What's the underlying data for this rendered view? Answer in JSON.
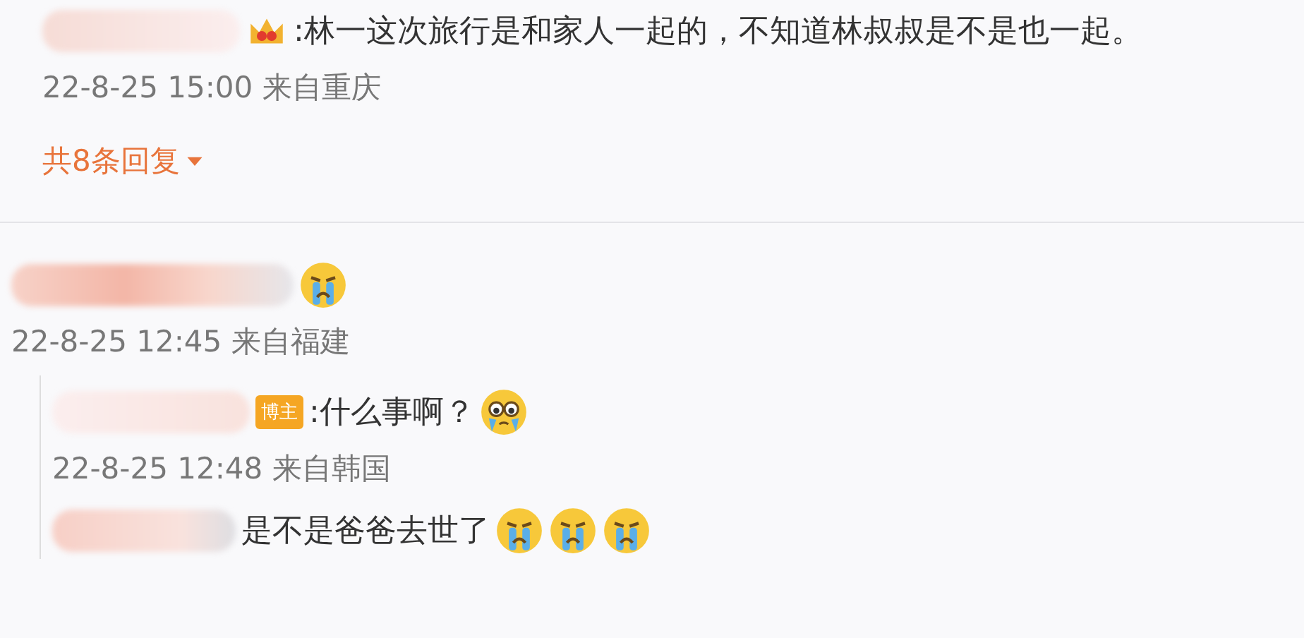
{
  "comment": {
    "badge": {
      "kind": "crown"
    },
    "text": ":林一这次旅行是和家人一起的，不知道林叔叔是不是也一起。",
    "time": "22-8-25 15:00 来自重庆",
    "replies_link": "共8条回复"
  },
  "reply": {
    "emojis": [
      {
        "kind": "crying"
      }
    ],
    "time": "22-8-25 12:45 来自福建"
  },
  "sub_replies": [
    {
      "badge": {
        "kind": "label",
        "text": "博主"
      },
      "text": ":什么事啊？",
      "emojis": [
        {
          "kind": "teary"
        }
      ],
      "time": "22-8-25 12:48 来自韩国"
    },
    {
      "text": "是不是爸爸去世了",
      "emojis": [
        {
          "kind": "crying"
        },
        {
          "kind": "crying"
        },
        {
          "kind": "crying"
        }
      ]
    }
  ]
}
